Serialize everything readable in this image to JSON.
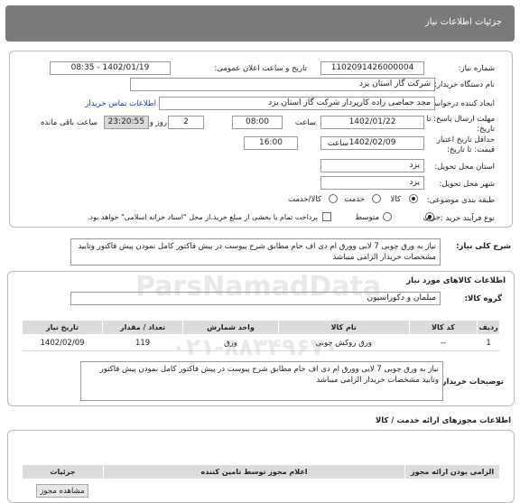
{
  "header": {
    "title": "جزئیات اطلاعات نیاز"
  },
  "form": {
    "need_number": {
      "label": "شماره نیاز:",
      "value": "1102091426000004"
    },
    "announce_date": {
      "label": "تاریخ و ساعت اعلان عمومی:",
      "value": "1402/01/19 - 08:35"
    },
    "buyer_org": {
      "label": "نام دستگاه خریدار:",
      "value": "شرکت گاز استان یزد"
    },
    "requester": {
      "label": "ایجاد کننده درخواست:",
      "value": "مجد حماصی زاده کارپرداز شرکت گاز استان یزد",
      "contact_link": "اطلاعات تماس خریدار"
    },
    "deadline": {
      "label_line1": "مهلت ارسال پاسخ: تا",
      "label_line2": "تاریخ:",
      "date": "1402/01/22",
      "time_label": "ساعت",
      "time": "08:00",
      "days": "2",
      "days_label": "روز و",
      "remaining": "23:20:55",
      "remaining_label": "ساعت باقی مانده"
    },
    "min_validity": {
      "label_line1": "حداقل تاریخ اعتبار",
      "label_line2": "قیمت: تا تاریخ:",
      "date": "1402/02/09",
      "time_label": "ساعت",
      "time": "16:00"
    },
    "province": {
      "label": "استان محل تحویل:",
      "value": "یزد"
    },
    "city": {
      "label": "شهر محل تحویل:",
      "value": "یزد"
    },
    "category": {
      "label": "طبقه بندی موضوعی:",
      "options": [
        "کالا",
        "خدمت",
        "کالا/خدمت"
      ],
      "selected": "کالا"
    },
    "process": {
      "label": "نوع فرآیند خرید :",
      "options": [
        "جزیی",
        "متوسط"
      ],
      "selected": "جزیی",
      "payment_note": "پرداخت تمام یا بخشی از مبلغ خرید،از محل \"اسناد خزانه اسلامی\" خواهد بود."
    }
  },
  "summary": {
    "label": "شرح کلی نیاز:",
    "text": "نیاز به ورق چوبی 7 لایی وورق ام دی اف خام مطابق شرح پیوست در پیش فاکتور کامل نمودن پیش فاکتور وتایید مشخصات خریدار الزامی میباشد"
  },
  "goods": {
    "section_title": "اطلاعات کالاهای مورد نیاز",
    "group_label": "گروه کالا:",
    "group_value": "مبلمان و دکوراسیون",
    "columns": [
      "ردیف",
      "کد کالا",
      "نام کالا",
      "واحد شمارش",
      "تعداد / مقدار",
      "تاریخ نیاز"
    ],
    "rows": [
      {
        "row": "1",
        "code": "--",
        "name": "ورق روکش چوبی",
        "unit": "ورق",
        "qty": "119",
        "date": "1402/02/09"
      }
    ],
    "buyer_notes_label": "توضیحات خریدار:",
    "buyer_notes": "نیاز به ورق چوبی 7 لایی وورق ام دی اف خام مطابق شرح پیوست در پیش فاکتور کامل نمودن پیش فاکتور وتایید مشخصات خریدار الزامی میباشد"
  },
  "services": {
    "section_title": "اطلاعات مجوزهای ارائه خدمت / کالا",
    "columns": [
      "الزامی بودن ارائه مجوز",
      "اعلام مجوز توسط تامین کننده",
      "جزئیات"
    ],
    "view_button": "مشاهده مجوز"
  },
  "watermark": {
    "brand": "ParsNamadData",
    "phone": "۰۲۱-۸۸۳۴۹۶۷۰"
  }
}
